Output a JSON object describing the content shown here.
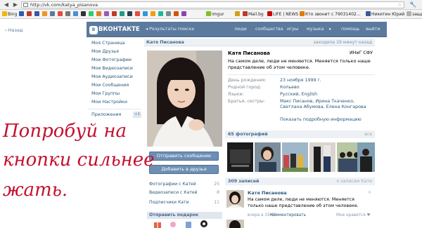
{
  "browser": {
    "url": "http://vk.com/katya_pisanova",
    "bookmarks": [
      {
        "label": "Bing",
        "color": "#f5b400"
      },
      {
        "label": "",
        "color": "#2a5db0"
      },
      {
        "label": "",
        "color": "#c0392b"
      },
      {
        "label": "",
        "color": "#3b5998"
      },
      {
        "label": "",
        "color": "#f7931e"
      },
      {
        "label": "",
        "color": "#5b7a9e"
      },
      {
        "label": "",
        "color": "#e74c3c"
      },
      {
        "label": "",
        "color": "#777777"
      },
      {
        "label": "",
        "color": "#4a90d9"
      },
      {
        "label": "",
        "color": "#333333"
      },
      {
        "label": "",
        "color": "#2ecc71"
      },
      {
        "label": "",
        "color": "#e67e22"
      },
      {
        "label": "",
        "color": "#9b59b6"
      },
      {
        "label": "",
        "color": "#c0392b"
      },
      {
        "label": "",
        "color": "#16a085"
      },
      {
        "label": "",
        "color": "#2c3e50"
      },
      {
        "label": "",
        "color": "#e74c3c"
      },
      {
        "label": "",
        "color": "#3498db"
      },
      {
        "label": "",
        "color": "#f39c12"
      },
      {
        "label": "",
        "color": "#1abc9c"
      },
      {
        "label": "",
        "color": "#7f8c8d"
      },
      {
        "label": "",
        "color": "#d35400"
      },
      {
        "label": "",
        "color": "#8e44ad"
      },
      {
        "label": "imgur",
        "color": "#85bf25"
      },
      {
        "label": "",
        "color": "#d4a017"
      },
      {
        "label": "Mail.bg",
        "color": "#c0392b"
      },
      {
        "label": "LIFE | NEWS",
        "color": "#cc0000"
      },
      {
        "label": "Кто звонит с 79031402...",
        "color": "#e07b00"
      },
      {
        "label": "Никитин Юрий",
        "color": "#3b5998"
      },
      {
        "label": "защит",
        "color": "#b0b0b0"
      }
    ]
  },
  "back_link": "Назад",
  "header": {
    "logo": "ВКОНТАКТЕ",
    "logo_badge": "В",
    "search_results": "Результаты поиска",
    "nav": [
      "люди",
      "сообщества",
      "игры",
      "музыка",
      "помощь",
      "выйти"
    ]
  },
  "menu": {
    "items": [
      "Моя Страница",
      "Мои Друзья",
      "Мои Фотографии",
      "Мои Видеозаписи",
      "Мои Аудиозаписи",
      "Мои Сообщения",
      "Мои Группы",
      "Мои Настройки"
    ],
    "apps": "Приложения",
    "apps_badge": "+1"
  },
  "profile": {
    "bar_name": "Катя Писанова",
    "online": "заходила 19 минут назад",
    "name": "Катя Писанова",
    "school": "ИНиГ СФУ",
    "status": "На самом деле, люди не меняются. Меняется только наше представление об этом человеке.",
    "fields": [
      {
        "label": "День рождения:",
        "value": "23 ноября 1999 г."
      },
      {
        "label": "Родной город:",
        "value": "Копьево"
      },
      {
        "label": "Языки:",
        "value": "Русский, English"
      },
      {
        "label": "Братья, сестры:",
        "value": "Макс Писанов, Ирина Ткаченко, Светлана Абумова, Елена Конгарова"
      }
    ],
    "show_more": "Показать подробную информацию"
  },
  "buttons": {
    "send_message": "Отправить сообщение",
    "add_friend": "Добавить в друзья"
  },
  "left_links": [
    {
      "label": "Фотографии с Катей",
      "count": "25"
    },
    {
      "label": "Видеозаписи с Катей",
      "count": "8"
    },
    {
      "label": "Подписчики Кати",
      "count": "11"
    }
  ],
  "gift": "Отправить подарок",
  "photos": {
    "title": "65 фотографий",
    "all": "все"
  },
  "wall": {
    "title": "309 записей",
    "filter": "к записям Кати",
    "post_author": "Катя Писанова",
    "post_text": "На самом деле, люди не меняются. Меняется только наше представление об этом человеке.",
    "post_time": "вчера в 19:40",
    "post_comment": "Комментировать",
    "post_like": "Мне нравится"
  },
  "overlay": {
    "lines": [
      "Попробуй на",
      "кнопки сильнее",
      "жать."
    ],
    "color": "#c4102e"
  },
  "colors": {
    "vk_blue": "#5b7a9e",
    "link": "#2b587a",
    "button": "#6d8fb3"
  }
}
